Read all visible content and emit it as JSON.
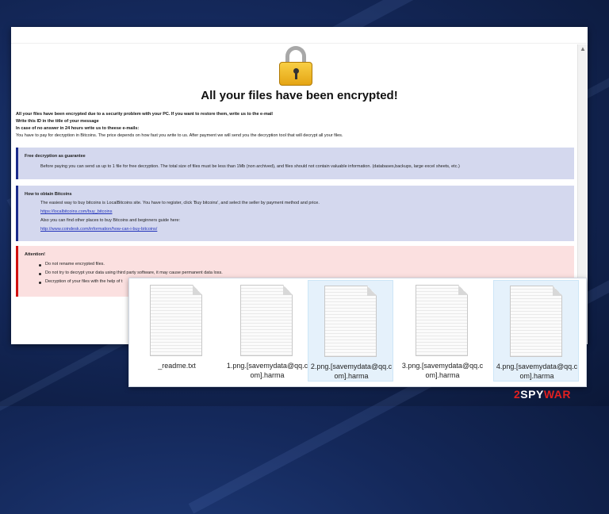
{
  "note": {
    "headline": "All your files have been encrypted!",
    "intro_bold": [
      "All your files have been encrypted due to a security problem with your PC. If you want to restore them, write us to the e-mail",
      "Write this ID in the title of your message",
      "In case of no answer in 24 hours write us to theese e-mails:"
    ],
    "intro_text": "You have to pay for decryption in Bitcoins. The price depends on how fast you write to us. After payment we will send you the decryption tool that will decrypt all your files.",
    "free_decryption": {
      "title": "Free decryption as guarantee",
      "text": "Before paying you can send us up to 1 file for free decryption. The total size of files must be less than 1Mb (non archived), and files should not contain valuable information. (databases,backups, large excel sheets, etc.)"
    },
    "how_to_obtain": {
      "title": "How to obtain Bitcoins",
      "line1": "The easiest way to buy bitcoins is LocalBitcoins site. You have to register, click 'Buy bitcoins', and select the seller by payment method and price.",
      "link1": "https://localbitcoins.com/buy_bitcoins",
      "line2": "Also you can find other places to buy Bitcoins and beginners guide here:",
      "link2": "http://www.coindesk.com/information/how-can-i-buy-bitcoins/"
    },
    "attention": {
      "title": "Attention!",
      "items": [
        "Do not rename encrypted files.",
        "Do not try to decrypt your data using third party software, it may cause permanent data loss.",
        "Decryption of your files with the help of t"
      ]
    }
  },
  "files": [
    {
      "name": "_readme.txt",
      "selected": false
    },
    {
      "name": "1.png.[savemydata@qq.com].harma",
      "selected": false
    },
    {
      "name": "2.png.[savemydata@qq.com].harma",
      "selected": true
    },
    {
      "name": "3.png.[savemydata@qq.com].harma",
      "selected": false
    },
    {
      "name": "4.png.[savemydata@qq.com].harma",
      "selected": true
    }
  ],
  "watermark": {
    "part1": "2",
    "part2": "SPY",
    "part3": "WAR"
  },
  "colors": {
    "accent_blue": "#1a2a8a",
    "alert_red": "#d01010",
    "lock_gold": "#f0b82a"
  }
}
